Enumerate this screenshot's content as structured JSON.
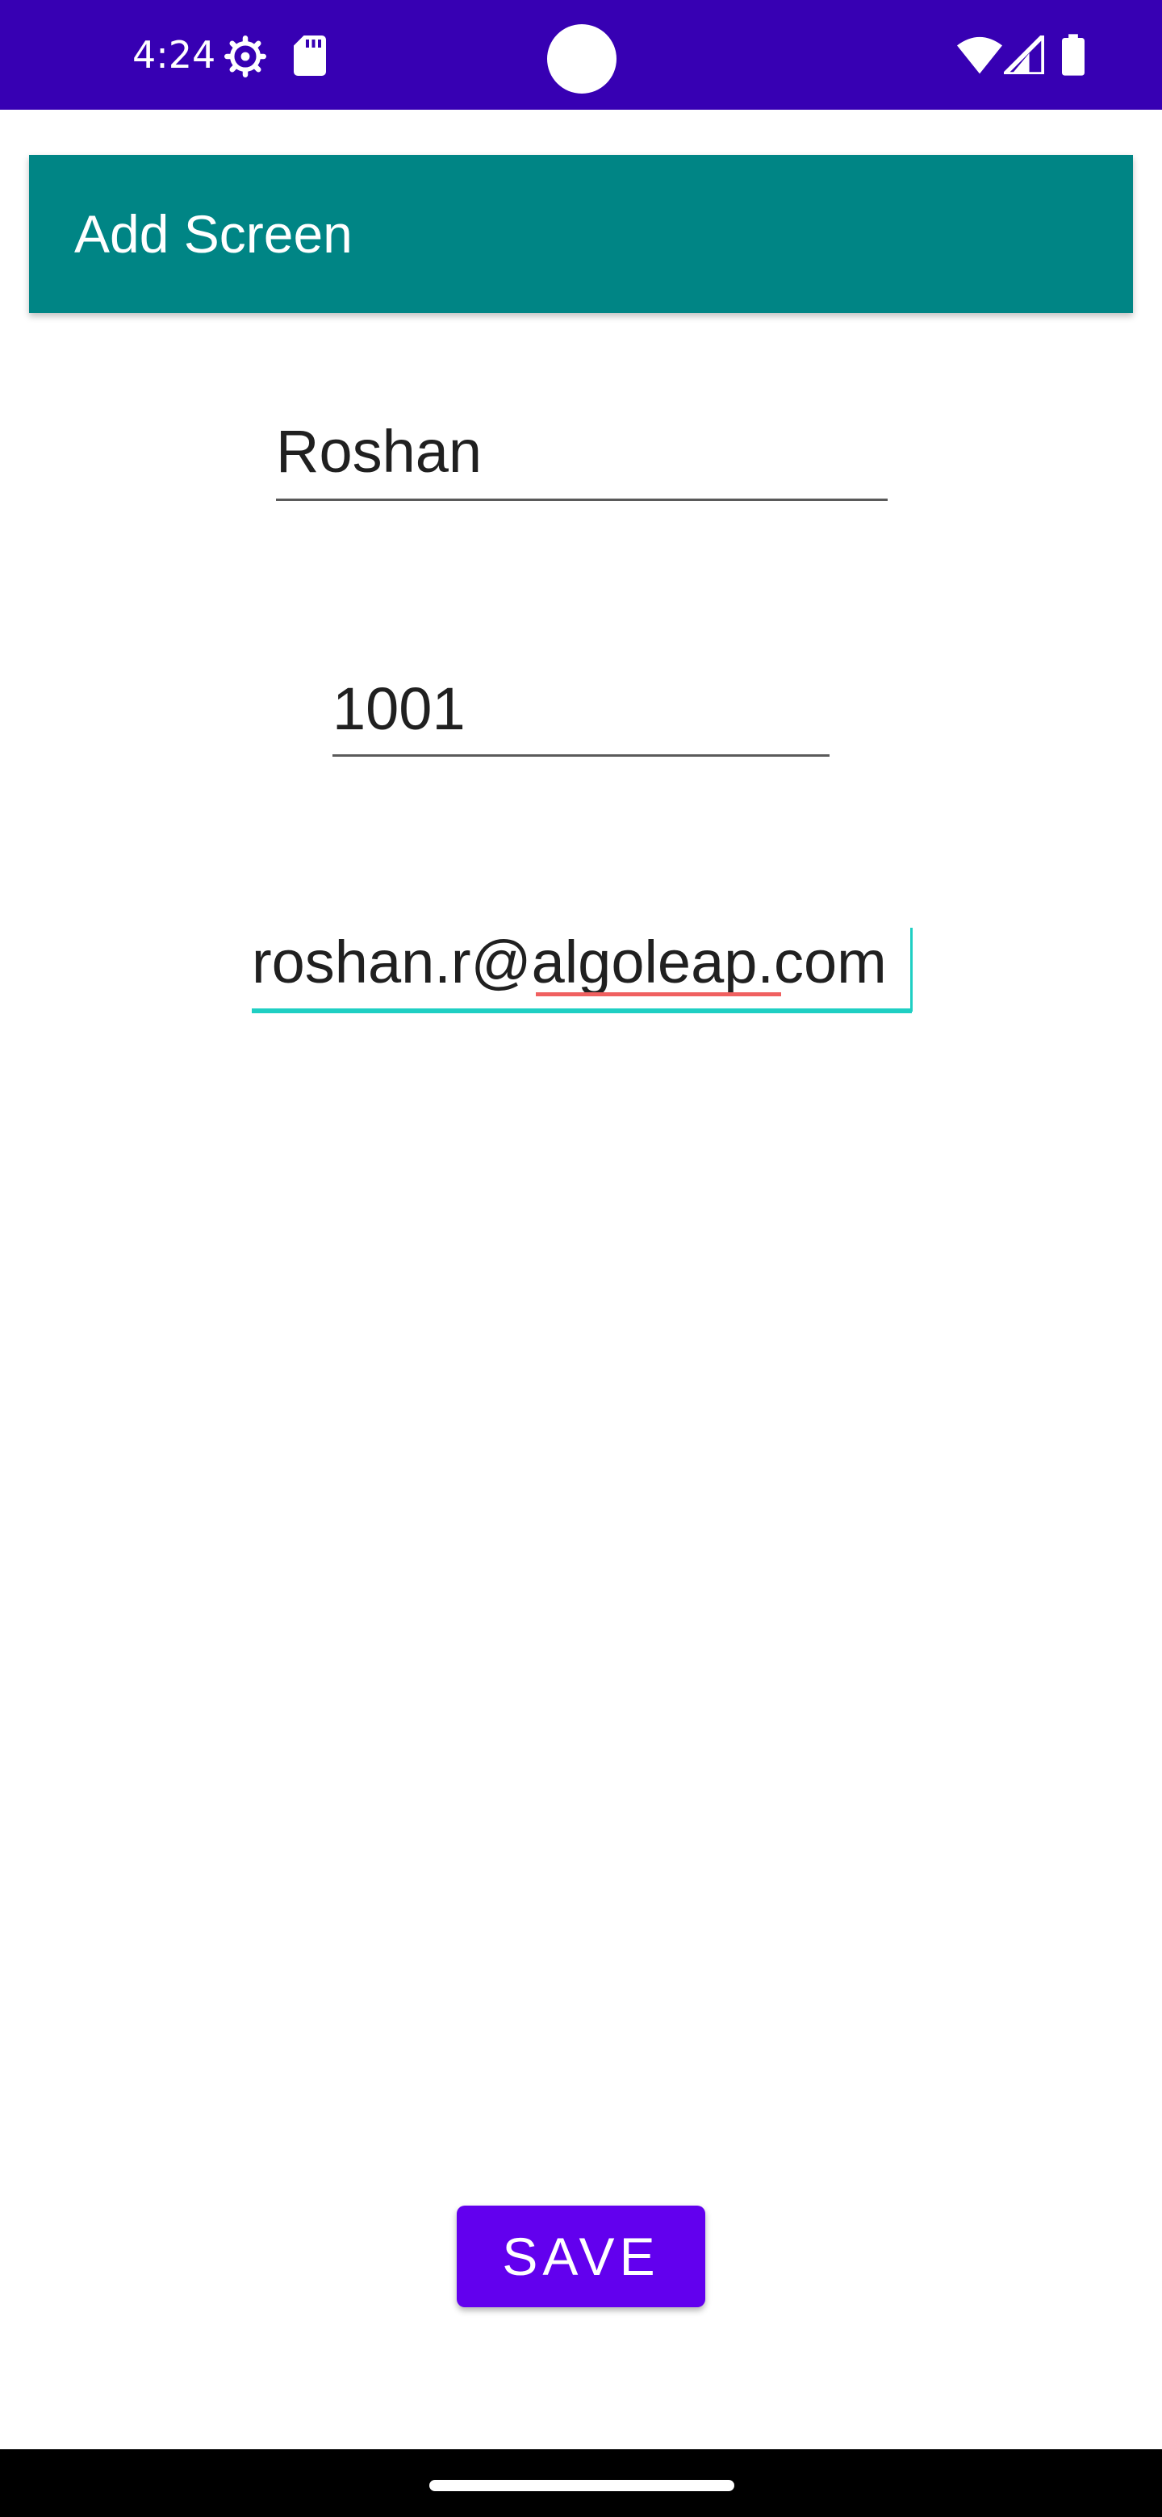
{
  "status_bar": {
    "time": "4:24",
    "icons": [
      "settings-gear-icon",
      "sd-card-icon",
      "wifi-icon",
      "signal-icon",
      "battery-icon"
    ],
    "background_color": "#3700b3"
  },
  "app_bar": {
    "title": "Add Screen",
    "background_color": "#008585"
  },
  "form": {
    "name_value": "Roshan",
    "id_value": "1001",
    "email_value": "roshan.r@algoleap.com",
    "focused_field": "email",
    "accent_color": "#1fcfc3"
  },
  "actions": {
    "save_label": "SAVE",
    "save_color": "#6200ee"
  }
}
